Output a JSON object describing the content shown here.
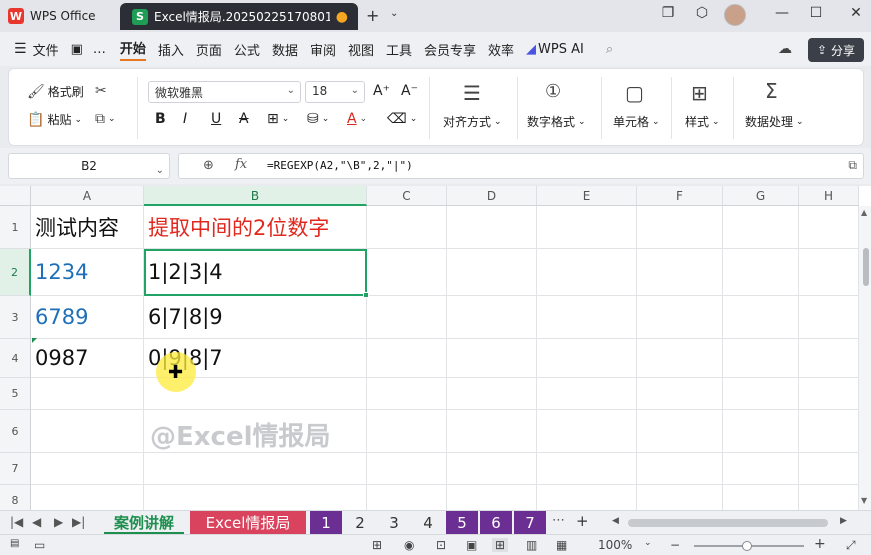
{
  "titlebar": {
    "app_name": "WPS Office",
    "doc_tab_title": "Excel情报局.20250225170801",
    "doc_icon_letter": "S",
    "unsaved_mark": "●"
  },
  "menu": {
    "items": [
      "文件",
      "开始",
      "插入",
      "页面",
      "公式",
      "数据",
      "审阅",
      "视图",
      "工具",
      "会员专享",
      "效率",
      "WPS AI"
    ],
    "active": "开始",
    "share_label": "分享"
  },
  "ribbon": {
    "format_painter": "格式刷",
    "paste": "粘贴",
    "font_name": "微软雅黑",
    "font_size": "18",
    "align": "对齐方式",
    "number_format": "数字格式",
    "cells": "单元格",
    "styles": "样式",
    "data_processing": "数据处理"
  },
  "formula_bar": {
    "name_box": "B2",
    "fx": "fx",
    "formula": "=REGEXP(A2,\"\\B\",2,\"|\")"
  },
  "columns": [
    "A",
    "B",
    "C",
    "D",
    "E",
    "F",
    "G",
    "H"
  ],
  "rows": [
    "1",
    "2",
    "3",
    "4",
    "5",
    "6",
    "7",
    "8"
  ],
  "cells": {
    "a1": "测试内容",
    "b1": "提取中间的2位数字",
    "a2": "1234",
    "b2": "1|2|3|4",
    "a3": "6789",
    "b3": "6|7|8|9",
    "a4": "0987",
    "b4": "0|9|8|7"
  },
  "watermark": "@Excel情报局",
  "sheet_tabs": [
    "案例讲解",
    "Excel情报局",
    "1",
    "2",
    "3",
    "4",
    "5",
    "6",
    "7"
  ],
  "active_sheet": "案例讲解",
  "status": {
    "zoom": "100%"
  },
  "colors": {
    "accent_green": "#21a366",
    "text_blue": "#1f6fb8",
    "text_red": "#e0281e",
    "tab_pink": "#d9435e",
    "tab_purple": "#6b2f94"
  }
}
